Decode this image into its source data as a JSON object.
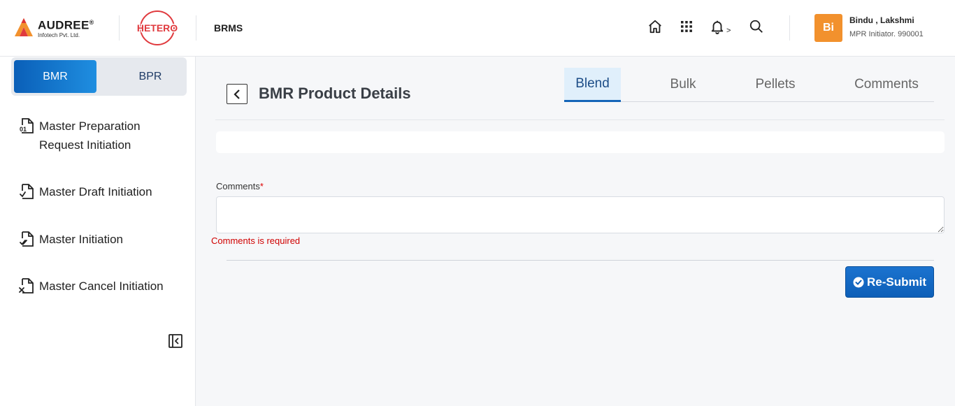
{
  "header": {
    "brand_name": "AUDREE",
    "brand_reg": "®",
    "brand_sub": "Infotech Pvt. Ltd.",
    "partner_logo": "HETERO",
    "app_name": "BRMS",
    "icons": [
      "home-icon",
      "apps-grid-icon",
      "bell-icon",
      "search-icon"
    ],
    "notification_suffix": ">",
    "user": {
      "initials": "Bi",
      "name": "Bindu , Lakshmi",
      "role": "MPR Initiator. 990001",
      "avatar_color": "#f2912d"
    }
  },
  "sidebar": {
    "toggle": {
      "active": "BMR",
      "inactive": "BPR"
    },
    "items": [
      {
        "label": "Master Preparation Request Initiation",
        "icon": "document-01-icon"
      },
      {
        "label": "Master Draft Initiation",
        "icon": "document-draft-icon"
      },
      {
        "label": "Master Initiation",
        "icon": "document-check-icon"
      },
      {
        "label": "Master Cancel Initiation",
        "icon": "document-cancel-icon"
      }
    ],
    "collapse_icon": "collapse-sidebar-icon"
  },
  "main": {
    "title": "BMR Product Details",
    "tabs": [
      {
        "label": "Blend",
        "active": true
      },
      {
        "label": "Bulk",
        "active": false
      },
      {
        "label": "Pellets",
        "active": false
      },
      {
        "label": "Comments",
        "active": false
      }
    ],
    "comments": {
      "label": "Comments",
      "required_mark": "*",
      "value": "",
      "error": "Comments is required"
    },
    "resubmit_label": "Re-Submit"
  },
  "colors": {
    "primary": "#0d5fb8",
    "accent_orange": "#f2912d",
    "error": "#d00000",
    "hetero_red": "#e03a3e"
  }
}
